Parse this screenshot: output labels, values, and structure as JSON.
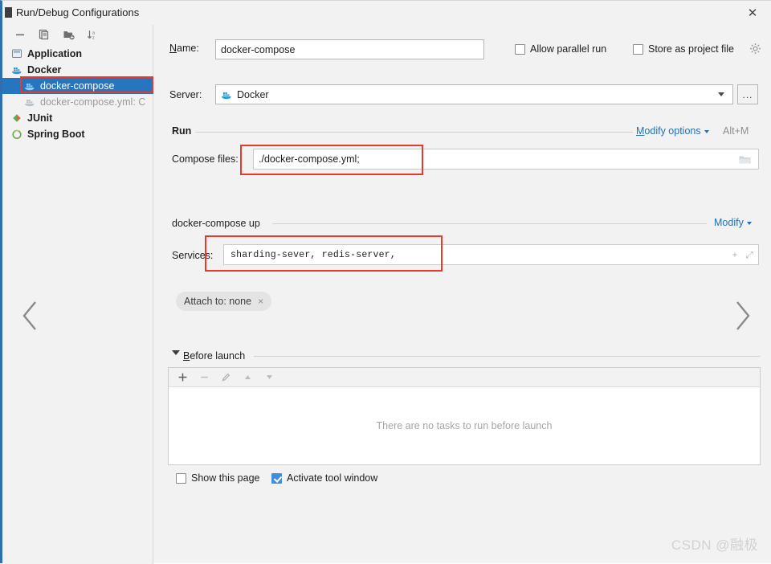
{
  "window": {
    "title": "Run/Debug Configurations",
    "close_label": "✕"
  },
  "sidebar": {
    "toolbar": [
      {
        "name": "remove-configuration",
        "label": "−"
      },
      {
        "name": "copy-configuration",
        "label": "copy"
      },
      {
        "name": "add-folder",
        "label": "folder+"
      },
      {
        "name": "sort-configurations",
        "label": "sort-az"
      }
    ],
    "tree": [
      {
        "label": "Application",
        "icon": "application-icon",
        "kind": "group",
        "selected": false
      },
      {
        "label": "Docker",
        "icon": "docker-icon",
        "kind": "group",
        "selected": false
      },
      {
        "label": "docker-compose",
        "icon": "docker-icon",
        "kind": "child",
        "selected": true
      },
      {
        "label": "docker-compose.yml: C",
        "icon": "docker-icon",
        "kind": "child-muted",
        "selected": false
      },
      {
        "label": "JUnit",
        "icon": "junit-icon",
        "kind": "group",
        "selected": false
      },
      {
        "label": "Spring Boot",
        "icon": "spring-icon",
        "kind": "group",
        "selected": false
      }
    ]
  },
  "form": {
    "name_label": "Name:",
    "name_mnemonic": "N",
    "name_value": "docker-compose",
    "allow_parallel_run": {
      "label": "Allow parallel run",
      "checked": false
    },
    "store_as_project_file": {
      "label": "Store as project file",
      "checked": false,
      "mnemonic": "S"
    },
    "server_label": "Server:",
    "server_value": "Docker",
    "ellipsis_label": "...",
    "run_section": {
      "title": "Run",
      "modify_options_label": "Modify options",
      "modify_options_mnemonic": "M",
      "shortcut": "Alt+M",
      "compose_files_label": "Compose files:",
      "compose_files_value": "./docker-compose.yml;"
    },
    "up_section": {
      "title": "docker-compose up",
      "modify_label": "Modify",
      "services_label": "Services:",
      "services_value": "sharding-sever, redis-server,",
      "add_icon": "+",
      "expand_icon": "⤢"
    },
    "attach_chip": {
      "label": "Attach to: none",
      "close": "×"
    },
    "before_launch": {
      "title": "Before launch",
      "mnemonic": "B",
      "toolbar": [
        {
          "name": "add-task-button",
          "label": "+"
        },
        {
          "name": "remove-task-button",
          "label": "−"
        },
        {
          "name": "edit-task-button",
          "label": "edit"
        },
        {
          "name": "move-task-up-button",
          "label": "▲"
        },
        {
          "name": "move-task-down-button",
          "label": "▼"
        }
      ],
      "empty_text": "There are no tasks to run before launch"
    },
    "show_this_page": {
      "label": "Show this page",
      "checked": false
    },
    "activate_tool_window": {
      "label": "Activate tool window",
      "checked": true
    }
  },
  "nav": {
    "prev": "‹",
    "next": "›"
  },
  "watermark": "CSDN @融极",
  "colors": {
    "accent": "#2675bf",
    "link": "#2470b3",
    "annotation": "#e8392c",
    "checkbox_checked": "#3f8de0"
  }
}
